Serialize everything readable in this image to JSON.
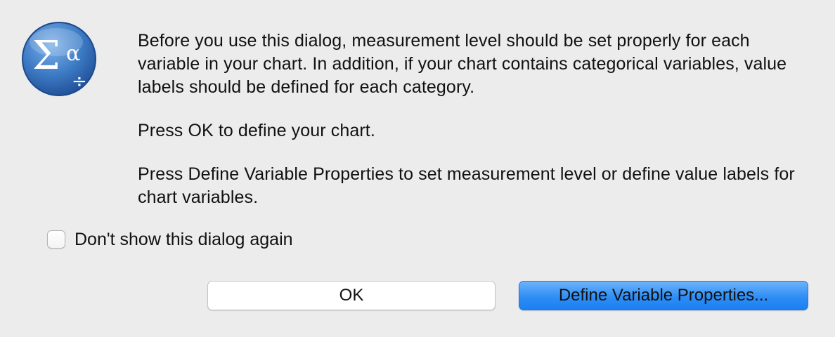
{
  "dialog": {
    "icon": "spss-sigma-alpha-icon",
    "message_paragraphs": [
      "Before you use this dialog, measurement level should be set properly for each variable in your chart. In addition, if your chart contains categorical variables, value labels should be defined for each category.",
      "Press OK to define your chart.",
      "Press Define Variable Properties to set measurement level or define value labels for chart variables."
    ],
    "checkbox": {
      "label": "Don't show this dialog again",
      "checked": false
    },
    "buttons": {
      "ok_label": "OK",
      "define_label": "Define Variable Properties..."
    }
  },
  "colors": {
    "background": "#ececec",
    "default_button": "#2f8ef5",
    "icon_blue": "#2f6db5"
  }
}
